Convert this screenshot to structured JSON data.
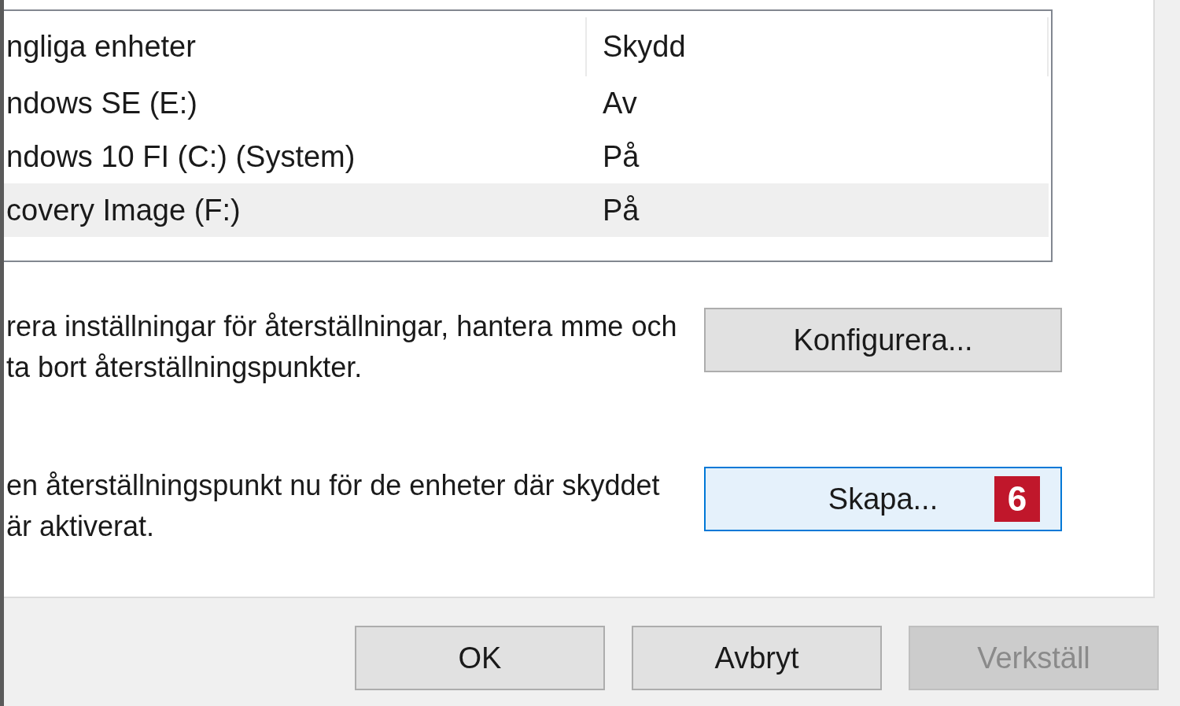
{
  "table": {
    "columns": [
      "ngliga enheter",
      "Skydd"
    ],
    "rows": [
      {
        "cells": [
          "ndows SE (E:)",
          "Av"
        ],
        "selected": false
      },
      {
        "cells": [
          "ndows 10 FI (C:) (System)",
          "På"
        ],
        "selected": false
      },
      {
        "cells": [
          "covery Image (F:)",
          "På"
        ],
        "selected": true
      }
    ]
  },
  "actions": [
    {
      "description": "rera inställningar för återställningar, hantera mme och ta bort återställningspunkter.",
      "button": {
        "label": "Konfigurera...",
        "focused": false
      }
    },
    {
      "description": "en återställningspunkt nu för de enheter där skyddet är aktiverat.",
      "button": {
        "label": "Skapa...",
        "focused": true,
        "badge": "6"
      }
    }
  ],
  "buttons": [
    {
      "label": "OK",
      "disabled": false
    },
    {
      "label": "Avbryt",
      "disabled": false
    },
    {
      "label": "Verkställ",
      "disabled": true
    }
  ]
}
